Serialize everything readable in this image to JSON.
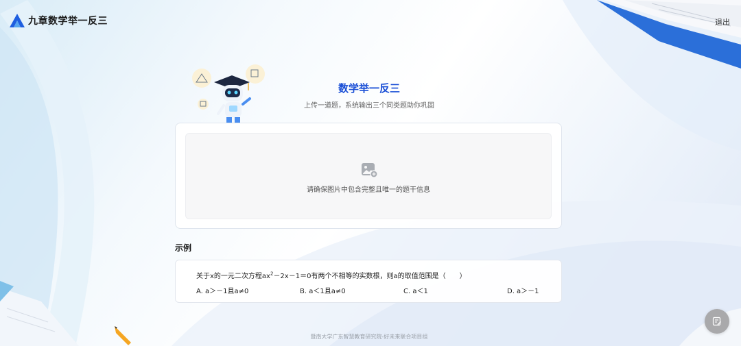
{
  "header": {
    "app_name": "九章数学举一反三",
    "logout_label": "退出"
  },
  "hero": {
    "title": "数学举一反三",
    "subtitle": "上传一道题，系统输出三个同类题助你巩固"
  },
  "upload": {
    "hint": "请确保图片中包含完整且唯一的题干信息",
    "icon": "image-add-icon"
  },
  "example": {
    "heading": "示例",
    "question_before": "关于x的一元二次方程ax",
    "question_sup": "2",
    "question_after": "－2x－1＝0有两个不相等的实数根，则a的取值范围是（　　）",
    "options": [
      "A.  a＞－1且a≠0",
      "B.  a＜1且a≠0",
      "C.  a＜1",
      "D.  a＞－1"
    ]
  },
  "footer": {
    "text": "暨南大学广东智慧教育研究院-好未来联合项目组"
  },
  "fab": {
    "icon": "edit-note-icon"
  },
  "colors": {
    "accent": "#1a4fd6",
    "logo_blue": "#1f5fe0",
    "fab_gray": "#a9a9ab"
  }
}
